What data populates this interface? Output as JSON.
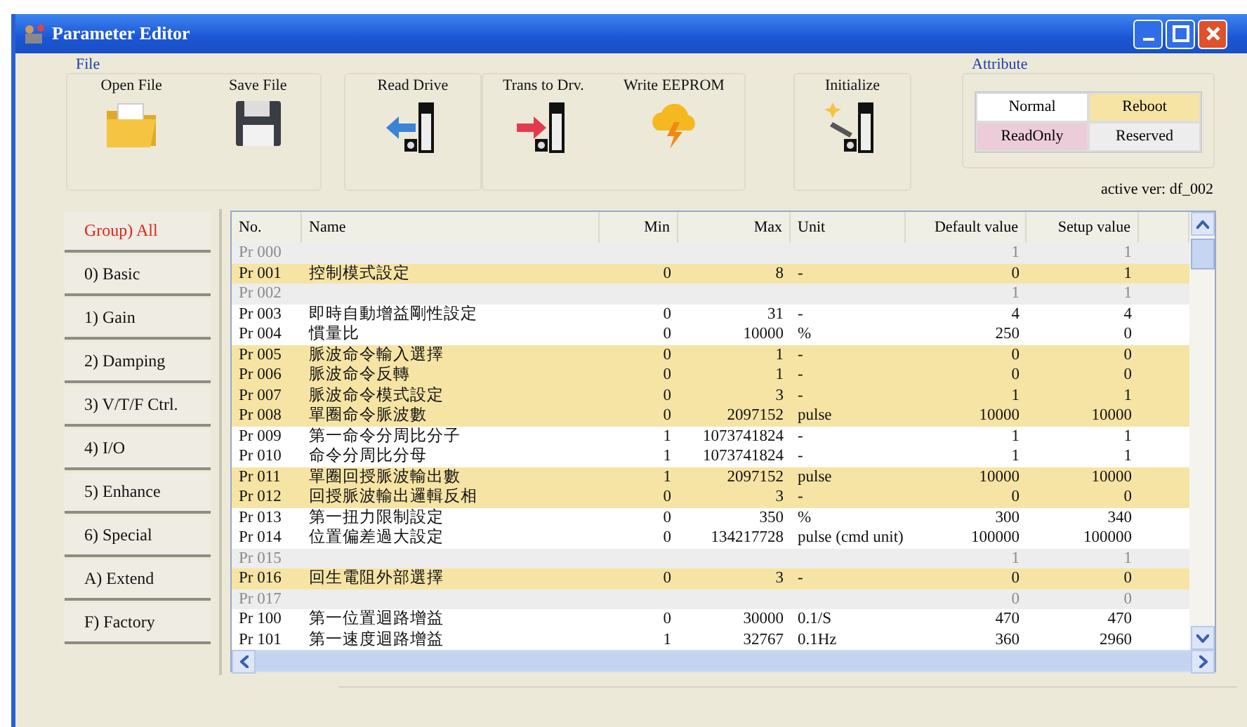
{
  "window": {
    "title": "Parameter Editor"
  },
  "toolbar": {
    "file_group": {
      "title": "File",
      "buttons": [
        {
          "kind": "open",
          "label": "Open File"
        },
        {
          "kind": "save",
          "label": "Save File"
        }
      ]
    },
    "groups": [
      [
        {
          "kind": "read",
          "label": "Read Drive"
        }
      ],
      [
        {
          "kind": "trans",
          "label": "Trans to Drv."
        },
        {
          "kind": "eeprom",
          "label": "Write EEPROM"
        }
      ],
      [
        {
          "kind": "init",
          "label": "Initialize"
        }
      ]
    ]
  },
  "attribute": {
    "title": "Attribute",
    "items": [
      {
        "kind": "normal",
        "label": "Normal",
        "color": "#ffffff"
      },
      {
        "kind": "reboot",
        "label": "Reboot",
        "color": "#f6e4a4"
      },
      {
        "kind": "readonly",
        "label": "ReadOnly",
        "color": "#ecccd8"
      },
      {
        "kind": "reserved",
        "label": "Reserved",
        "color": "#ededed"
      }
    ],
    "active_version": "active ver: df_002"
  },
  "groups": [
    {
      "label": "Group) All",
      "selected": true
    },
    {
      "label": "0) Basic",
      "selected": false
    },
    {
      "label": "1) Gain",
      "selected": false
    },
    {
      "label": "2) Damping",
      "selected": false
    },
    {
      "label": "3) V/T/F Ctrl.",
      "selected": false
    },
    {
      "label": "4) I/O",
      "selected": false
    },
    {
      "label": "5) Enhance",
      "selected": false
    },
    {
      "label": "6) Special",
      "selected": false
    },
    {
      "label": "A) Extend",
      "selected": false
    },
    {
      "label": "F) Factory",
      "selected": false
    }
  ],
  "table": {
    "columns": [
      "No.",
      "Name",
      "Min",
      "Max",
      "Unit",
      "Default value",
      "Setup value"
    ],
    "rows": [
      {
        "kind": "reserved",
        "no": "Pr 000",
        "name": "",
        "min": "",
        "max": "",
        "unit": "",
        "default": "1",
        "setup": "1"
      },
      {
        "kind": "reboot",
        "no": "Pr 001",
        "name": "控制模式設定",
        "min": "0",
        "max": "8",
        "unit": "-",
        "default": "0",
        "setup": "1"
      },
      {
        "kind": "reserved",
        "no": "Pr 002",
        "name": "",
        "min": "",
        "max": "",
        "unit": "",
        "default": "1",
        "setup": "1"
      },
      {
        "kind": "normal",
        "no": "Pr 003",
        "name": "即時自動增益剛性設定",
        "min": "0",
        "max": "31",
        "unit": "-",
        "default": "4",
        "setup": "4"
      },
      {
        "kind": "normal",
        "no": "Pr 004",
        "name": "慣量比",
        "min": "0",
        "max": "10000",
        "unit": "%",
        "default": "250",
        "setup": "0"
      },
      {
        "kind": "reboot",
        "no": "Pr 005",
        "name": "脈波命令輸入選擇",
        "min": "0",
        "max": "1",
        "unit": "-",
        "default": "0",
        "setup": "0"
      },
      {
        "kind": "reboot",
        "no": "Pr 006",
        "name": "脈波命令反轉",
        "min": "0",
        "max": "1",
        "unit": "-",
        "default": "0",
        "setup": "0"
      },
      {
        "kind": "reboot",
        "no": "Pr 007",
        "name": "脈波命令模式設定",
        "min": "0",
        "max": "3",
        "unit": "-",
        "default": "1",
        "setup": "1"
      },
      {
        "kind": "reboot",
        "no": "Pr 008",
        "name": "單圈命令脈波數",
        "min": "0",
        "max": "2097152",
        "unit": "pulse",
        "default": "10000",
        "setup": "10000"
      },
      {
        "kind": "normal",
        "no": "Pr 009",
        "name": "第一命令分周比分子",
        "min": "1",
        "max": "1073741824",
        "unit": "-",
        "default": "1",
        "setup": "1"
      },
      {
        "kind": "normal",
        "no": "Pr 010",
        "name": "命令分周比分母",
        "min": "1",
        "max": "1073741824",
        "unit": "-",
        "default": "1",
        "setup": "1"
      },
      {
        "kind": "reboot",
        "no": "Pr 011",
        "name": "單圈回授脈波輸出數",
        "min": "1",
        "max": "2097152",
        "unit": "pulse",
        "default": "10000",
        "setup": "10000"
      },
      {
        "kind": "reboot",
        "no": "Pr 012",
        "name": "回授脈波輸出邏輯反相",
        "min": "0",
        "max": "3",
        "unit": "-",
        "default": "0",
        "setup": "0"
      },
      {
        "kind": "normal",
        "no": "Pr 013",
        "name": "第一扭力限制設定",
        "min": "0",
        "max": "350",
        "unit": "%",
        "default": "300",
        "setup": "340"
      },
      {
        "kind": "normal",
        "no": "Pr 014",
        "name": "位置偏差過大設定",
        "min": "0",
        "max": "134217728",
        "unit": "pulse (cmd unit)",
        "default": "100000",
        "setup": "100000"
      },
      {
        "kind": "reserved",
        "no": "Pr 015",
        "name": "",
        "min": "",
        "max": "",
        "unit": "",
        "default": "1",
        "setup": "1"
      },
      {
        "kind": "reboot",
        "no": "Pr 016",
        "name": "回生電阻外部選擇",
        "min": "0",
        "max": "3",
        "unit": "-",
        "default": "0",
        "setup": "0"
      },
      {
        "kind": "reserved",
        "no": "Pr 017",
        "name": "",
        "min": "",
        "max": "",
        "unit": "",
        "default": "0",
        "setup": "0"
      },
      {
        "kind": "normal",
        "no": "Pr 100",
        "name": "第一位置迴路增益",
        "min": "0",
        "max": "30000",
        "unit": "0.1/S",
        "default": "470",
        "setup": "470"
      },
      {
        "kind": "normal",
        "no": "Pr 101",
        "name": "第一速度迴路增益",
        "min": "1",
        "max": "32767",
        "unit": "0.1Hz",
        "default": "360",
        "setup": "2960"
      }
    ]
  }
}
